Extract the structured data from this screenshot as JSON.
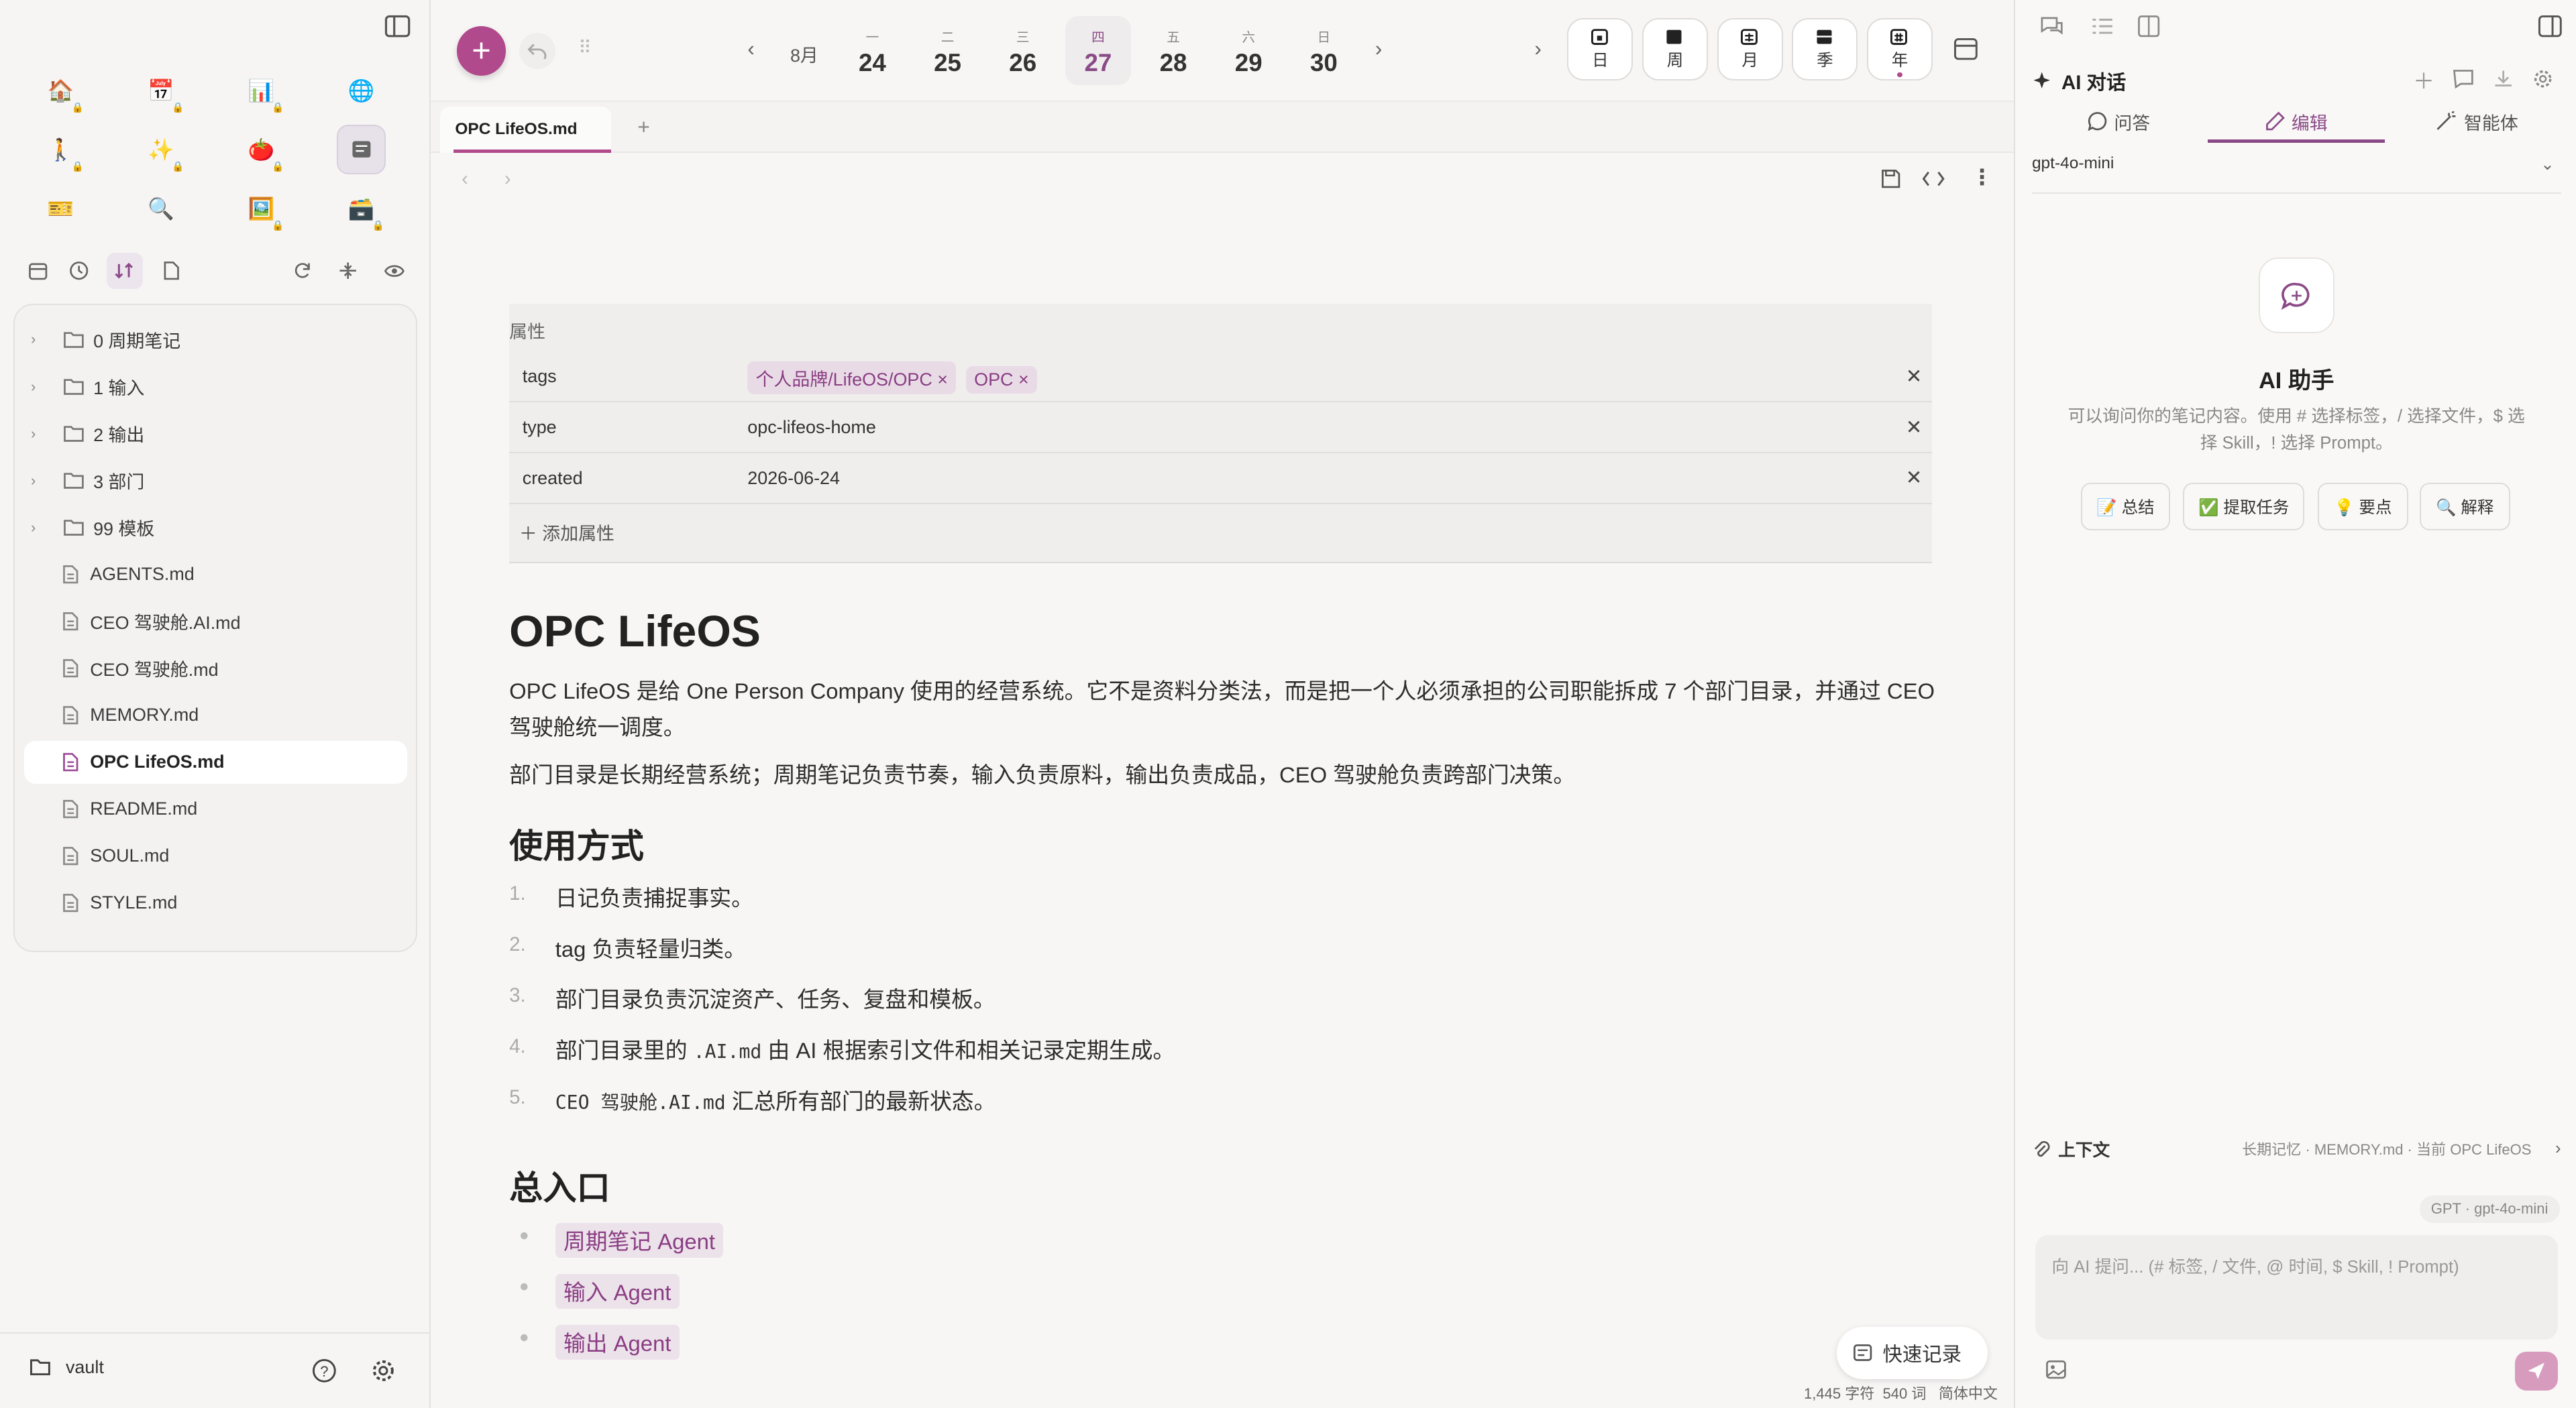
{
  "window_title": "OPC LifeOS.md",
  "left": {
    "tree": [
      {
        "type": "folder",
        "label": "0 周期笔记"
      },
      {
        "type": "folder",
        "label": "1 输入"
      },
      {
        "type": "folder",
        "label": "2 输出"
      },
      {
        "type": "folder",
        "label": "3 部门"
      },
      {
        "type": "folder",
        "label": "99 模板"
      },
      {
        "type": "file",
        "label": "AGENTS.md"
      },
      {
        "type": "file",
        "label": "CEO 驾驶舱.AI.md"
      },
      {
        "type": "file",
        "label": "CEO 驾驶舱.md"
      },
      {
        "type": "file",
        "label": "MEMORY.md"
      },
      {
        "type": "file",
        "label": "OPC LifeOS.md",
        "selected": true
      },
      {
        "type": "file",
        "label": "README.md"
      },
      {
        "type": "file",
        "label": "SOUL.md"
      },
      {
        "type": "file",
        "label": "STYLE.md"
      }
    ],
    "vault_label": "vault"
  },
  "calendar": {
    "month": "8月",
    "days": [
      {
        "wk": "一",
        "d": "24"
      },
      {
        "wk": "二",
        "d": "25"
      },
      {
        "wk": "三",
        "d": "26"
      },
      {
        "wk": "四",
        "d": "27",
        "today": true
      },
      {
        "wk": "五",
        "d": "28"
      },
      {
        "wk": "六",
        "d": "29"
      },
      {
        "wk": "日",
        "d": "30"
      }
    ],
    "ranges": [
      "日",
      "周",
      "月",
      "季",
      "年"
    ]
  },
  "tabs": [
    {
      "label": "OPC LifeOS.md",
      "active": true
    }
  ],
  "properties": {
    "header": "属性",
    "rows": [
      {
        "key": "tags",
        "tags": [
          "个人品牌/LifeOS/OPC",
          "OPC"
        ]
      },
      {
        "key": "type",
        "value": "opc-lifeos-home"
      },
      {
        "key": "created",
        "value": "2026-06-24"
      }
    ],
    "add_label": "添加属性"
  },
  "doc": {
    "title": "OPC LifeOS",
    "p1": "OPC LifeOS 是给 One Person Company 使用的经营系统。它不是资料分类法，而是把一个人必须承担的公司职能拆成 7 个部门目录，并通过 CEO 驾驶舱统一调度。",
    "p2": "部门目录是长期经营系统；周期笔记负责节奏，输入负责原料，输出负责成品，CEO 驾驶舱负责跨部门决策。",
    "h2_usage": "使用方式",
    "usage": [
      {
        "n": "1.",
        "pre": "",
        "code": "",
        "text": "日记负责捕捉事实。"
      },
      {
        "n": "2.",
        "pre": "",
        "code": "",
        "text": "tag 负责轻量归类。"
      },
      {
        "n": "3.",
        "pre": "",
        "code": "",
        "text": "部门目录负责沉淀资产、任务、复盘和模板。"
      },
      {
        "n": "4.",
        "pre": "部门目录里的 ",
        "code": ".AI.md",
        "text": " 由 AI 根据索引文件和相关记录定期生成。"
      },
      {
        "n": "5.",
        "pre": "",
        "code": "CEO 驾驶舱.AI.md",
        "text": " 汇总所有部门的最新状态。"
      }
    ],
    "h2_entry": "总入口",
    "entries": [
      "周期笔记 Agent",
      "输入 Agent",
      "输出 Agent"
    ]
  },
  "quick_record": "快速记录",
  "status": {
    "chars": "1,445 字符",
    "words": "540 词",
    "lang": "简体中文"
  },
  "ai": {
    "title": "AI 对话",
    "modes": [
      "问答",
      "编辑",
      "智能体"
    ],
    "active_mode": "编辑",
    "model": "gpt-4o-mini",
    "assistant_title": "AI 助手",
    "assistant_desc": "可以询问你的笔记内容。使用 # 选择标签，/ 选择文件，$ 选择 Skill，! 选择 Prompt。",
    "chips": [
      "📝 总结",
      "✅ 提取任务",
      "💡 要点",
      "🔍 解释"
    ],
    "context_label": "上下文",
    "context_info": "长期记忆 · MEMORY.md · 当前 OPC LifeOS",
    "model_badge": "GPT · gpt-4o-mini",
    "input_placeholder": "向 AI 提问... (# 标签, / 文件, @ 时间, $ Skill, ! Prompt)"
  },
  "colors": {
    "accent": "#b04a8c",
    "accent_dark": "#8a4a87",
    "tag_bg": "#e8dbe6"
  }
}
